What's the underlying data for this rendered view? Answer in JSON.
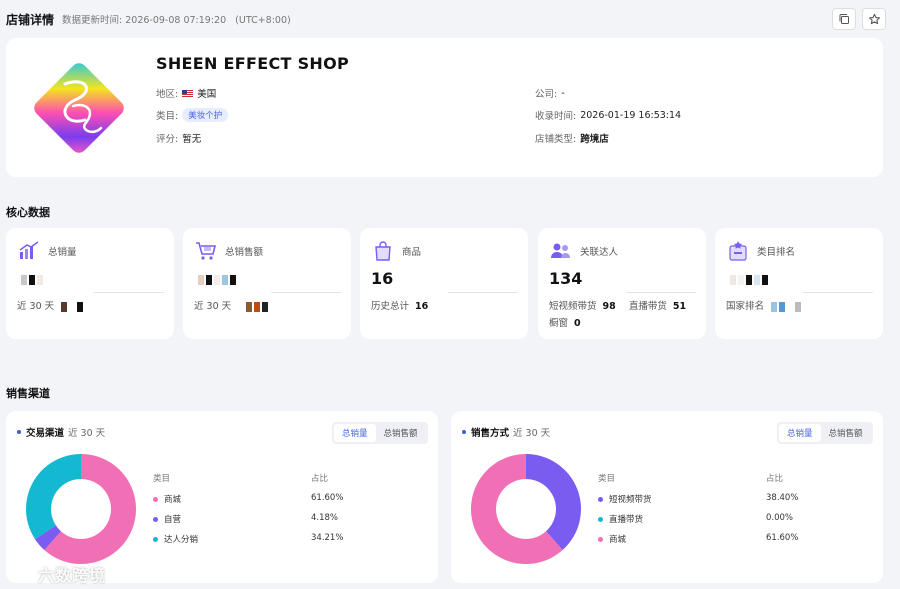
{
  "header": {
    "title": "店铺详情",
    "updated_label": "数据更新时间: 2026-09-08 07:19:20",
    "timezone": "(UTC+8:00)"
  },
  "shop": {
    "name": "SHEEN EFFECT SHOP",
    "region_label": "地区:",
    "region": "美国",
    "category_label": "类目:",
    "category": "美妆个护",
    "rating_label": "评分:",
    "rating": "暂无",
    "company_label": "公司:",
    "company": "-",
    "collected_label": "收录时间:",
    "collected": "2026-01-19 16:53:14",
    "type_label": "店铺类型:",
    "type": "跨境店"
  },
  "core": {
    "title": "核心数据",
    "cards": [
      {
        "label": "总销量",
        "value": "",
        "sub_label": "近 30 天",
        "color": "#6b4ef0"
      },
      {
        "label": "总销售额",
        "value": "",
        "sub_label": "近 30 天",
        "color": "#6b4ef0"
      },
      {
        "label": "商品",
        "value": "16",
        "sub_label": "历史总计",
        "sub_value": "16",
        "color": "#6b4ef0"
      },
      {
        "label": "关联达人",
        "value": "134",
        "sub_a_label": "短视频带货",
        "sub_a_value": "98",
        "sub_b_label": "直播带货",
        "sub_b_value": "51",
        "sub_c_label": "橱窗",
        "sub_c_value": "0",
        "color": "#6b4ef0"
      },
      {
        "label": "类目排名",
        "value": "",
        "sub_label": "国家排名",
        "color": "#6b4ef0"
      }
    ]
  },
  "channels": {
    "title": "销售渠道",
    "left": {
      "title": "交易渠道",
      "period": "近 30 天",
      "tab_active": "总销量",
      "tab_other": "总销售额",
      "col_category": "类目",
      "col_share": "占比",
      "rows": [
        {
          "name": "商城",
          "pct": "61.60%",
          "value": 61.6,
          "color": "#f06fb5"
        },
        {
          "name": "自营",
          "pct": "4.18%",
          "value": 4.18,
          "color": "#7b5cf0"
        },
        {
          "name": "达人分销",
          "pct": "34.21%",
          "value": 34.21,
          "color": "#14b8d0"
        }
      ]
    },
    "right": {
      "title": "销售方式",
      "period": "近 30 天",
      "tab_active": "总销量",
      "tab_other": "总销售额",
      "col_category": "类目",
      "col_share": "占比",
      "rows": [
        {
          "name": "短视频带货",
          "pct": "38.40%",
          "value": 38.4,
          "color": "#7b5cf0"
        },
        {
          "name": "直播带货",
          "pct": "0.00%",
          "value": 0.0,
          "color": "#14b8d0"
        },
        {
          "name": "商城",
          "pct": "61.60%",
          "value": 61.6,
          "color": "#f06fb5"
        }
      ]
    }
  },
  "watermark": "六数跨境"
}
